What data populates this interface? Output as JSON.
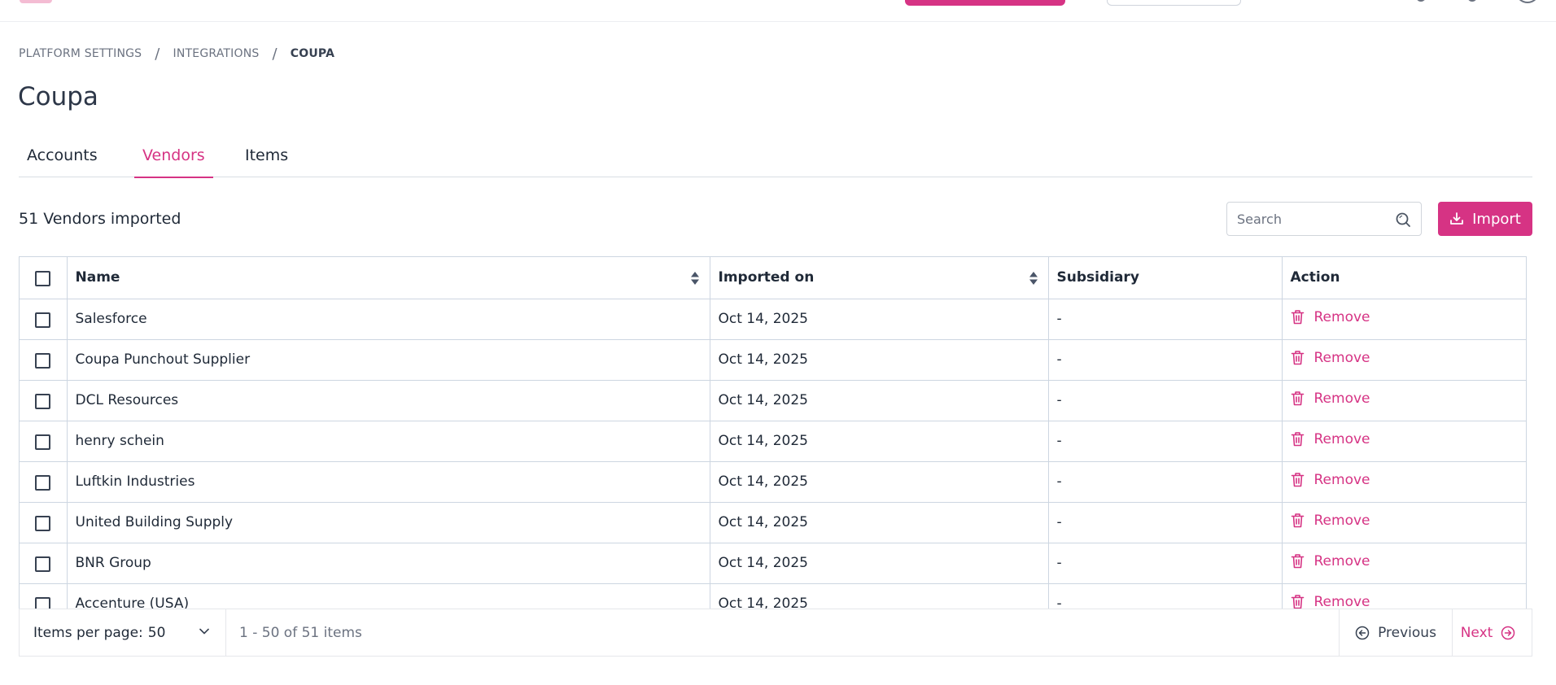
{
  "colors": {
    "accent": "#d63384",
    "border": "#cdd6e1",
    "muted": "#6b7280",
    "text": "#1f2937"
  },
  "breadcrumb": {
    "items": [
      "PLATFORM SETTINGS",
      "INTEGRATIONS",
      "COUPA"
    ],
    "separator": "/"
  },
  "page": {
    "title": "Coupa"
  },
  "tabs": [
    {
      "label": "Accounts",
      "active": false
    },
    {
      "label": "Vendors",
      "active": true
    },
    {
      "label": "Items",
      "active": false
    }
  ],
  "summary": {
    "count_text": "51 Vendors imported"
  },
  "search": {
    "placeholder": "Search",
    "value": "",
    "icon": "search-icon"
  },
  "import_button": {
    "label": "Import",
    "icon": "download-icon"
  },
  "table": {
    "columns": [
      "Name",
      "Imported on",
      "Subsidiary",
      "Action"
    ],
    "sortable": [
      "Name",
      "Imported on"
    ],
    "rows": [
      {
        "name": "Salesforce",
        "imported_on": "Oct 14, 2025",
        "subsidiary": "-",
        "action": "Remove"
      },
      {
        "name": "Coupa Punchout Supplier",
        "imported_on": "Oct 14, 2025",
        "subsidiary": "-",
        "action": "Remove"
      },
      {
        "name": "DCL Resources",
        "imported_on": "Oct 14, 2025",
        "subsidiary": "-",
        "action": "Remove"
      },
      {
        "name": "henry schein",
        "imported_on": "Oct 14, 2025",
        "subsidiary": "-",
        "action": "Remove"
      },
      {
        "name": "Luftkin Industries",
        "imported_on": "Oct 14, 2025",
        "subsidiary": "-",
        "action": "Remove"
      },
      {
        "name": "United Building Supply",
        "imported_on": "Oct 14, 2025",
        "subsidiary": "-",
        "action": "Remove"
      },
      {
        "name": "BNR Group",
        "imported_on": "Oct 14, 2025",
        "subsidiary": "-",
        "action": "Remove"
      },
      {
        "name": "Accenture (USA)",
        "imported_on": "Oct 14, 2025",
        "subsidiary": "-",
        "action": "Remove"
      }
    ]
  },
  "pagination": {
    "items_per_page_label": "Items per page:",
    "items_per_page_value": "50",
    "range_text": "1 - 50 of 51 items",
    "previous_label": "Previous",
    "next_label": "Next"
  }
}
